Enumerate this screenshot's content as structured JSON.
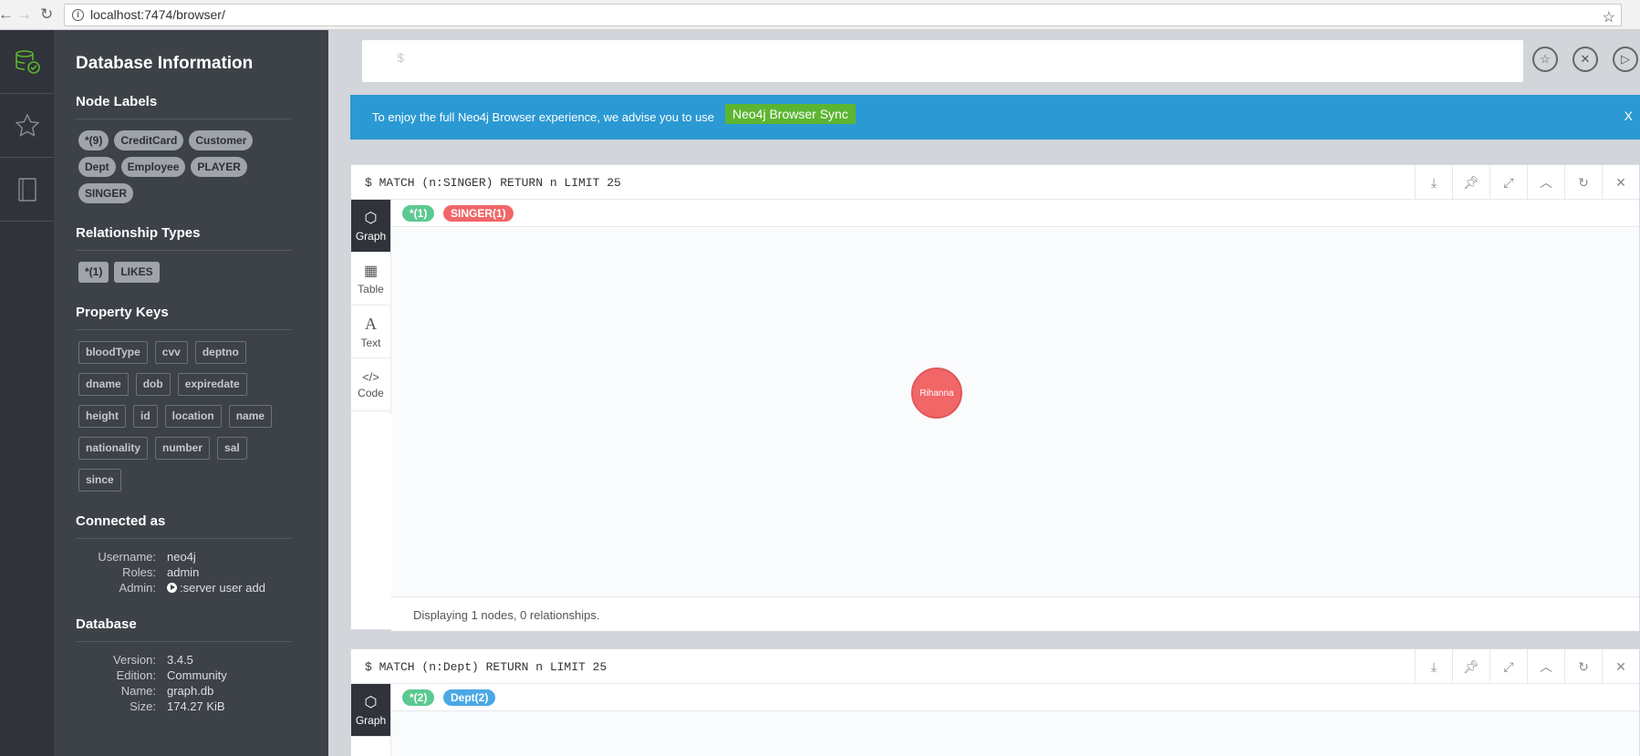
{
  "browser": {
    "url": "localhost:7474/browser/",
    "back": "←",
    "forward": "→",
    "reload": "↻",
    "info": "i",
    "star": "☆"
  },
  "sidebar": {
    "title": "Database Information",
    "node_labels_heading": "Node Labels",
    "node_labels": [
      "*(9)",
      "CreditCard",
      "Customer",
      "Dept",
      "Employee",
      "PLAYER",
      "SINGER"
    ],
    "rel_types_heading": "Relationship Types",
    "rel_types": [
      "*(1)",
      "LIKES"
    ],
    "prop_keys_heading": "Property Keys",
    "prop_keys": [
      "bloodType",
      "cvv",
      "deptno",
      "dname",
      "dob",
      "expiredate",
      "height",
      "id",
      "location",
      "name",
      "nationality",
      "number",
      "sal",
      "since"
    ],
    "connected_heading": "Connected as",
    "username_label": "Username:",
    "username": "neo4j",
    "roles_label": "Roles:",
    "roles": "admin",
    "admin_label": "Admin:",
    "admin": ":server user add",
    "db_heading": "Database",
    "version_label": "Version:",
    "version": "3.4.5",
    "edition_label": "Edition:",
    "edition": "Community",
    "name_label": "Name:",
    "name": "graph.db",
    "size_label": "Size:",
    "size": "174.27 KiB"
  },
  "editor": {
    "prompt": "$"
  },
  "banner": {
    "text": "To enjoy the full Neo4j Browser experience, we advise you to use",
    "button": "Neo4j Browser Sync",
    "close": "X"
  },
  "frames": [
    {
      "query": "$ MATCH (n:SINGER) RETURN n LIMIT 25",
      "pills": [
        {
          "label": "*(1)",
          "color": "#5bc991"
        },
        {
          "label": "SINGER(1)",
          "color": "#f16667"
        }
      ],
      "nodes": [
        "Rihanna"
      ],
      "status": "Displaying 1 nodes, 0 relationships."
    },
    {
      "query": "$ MATCH (n:Dept) RETURN n LIMIT 25",
      "pills": [
        {
          "label": "*(2)",
          "color": "#5bc991"
        },
        {
          "label": "Dept(2)",
          "color": "#4aa8e5"
        }
      ]
    }
  ],
  "tabs": [
    "Graph",
    "Table",
    "Text",
    "Code"
  ]
}
